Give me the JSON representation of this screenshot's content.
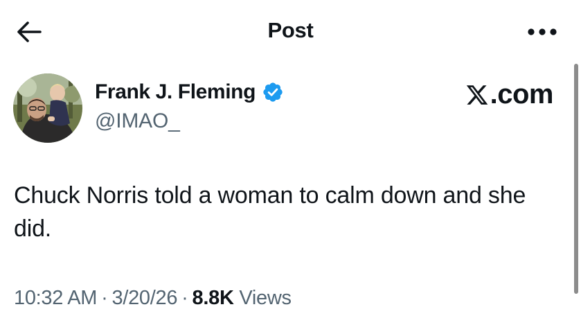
{
  "header": {
    "title": "Post",
    "back_icon": "arrow-left-icon",
    "more_icon": "more-horizontal-icon"
  },
  "author": {
    "name": "Frank J. Fleming",
    "handle": "@IMAO_",
    "verified": true,
    "verified_color": "#1d9bf0"
  },
  "watermark": {
    "text": ".com",
    "logo_icon": "x-logo-icon"
  },
  "tweet": {
    "text": "Chuck Norris told a woman to calm down and she did."
  },
  "meta": {
    "time": "10:32 AM",
    "date": "3/20/26",
    "separator": "·",
    "views_count": "8.8K",
    "views_label": "Views"
  },
  "colors": {
    "text_primary": "#0f1419",
    "text_secondary": "#536471",
    "accent": "#1d9bf0"
  }
}
